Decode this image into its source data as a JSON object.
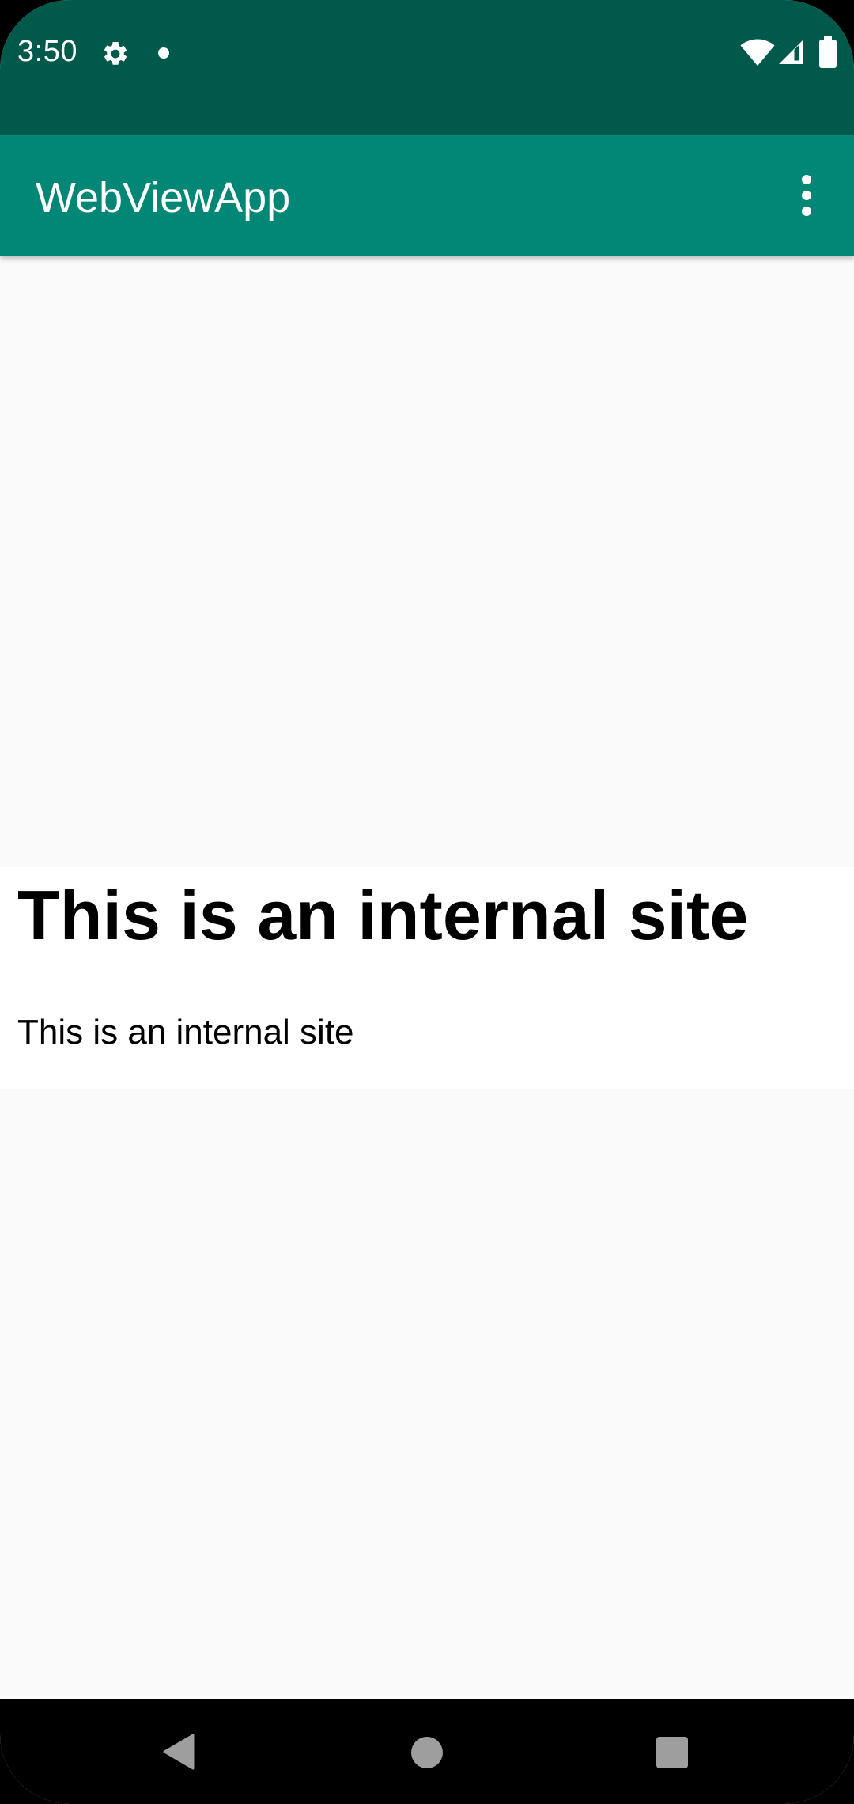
{
  "status_bar": {
    "time": "3:50",
    "icons": [
      "settings-icon",
      "notification-dot-icon",
      "wifi-icon",
      "signal-icon",
      "battery-icon"
    ]
  },
  "app_bar": {
    "title": "WebViewApp",
    "menu_icon": "more-vert-icon"
  },
  "webview": {
    "heading": "This is an internal site",
    "paragraph": "This is an internal site"
  },
  "nav_bar": {
    "buttons": [
      "back-icon",
      "home-icon",
      "recents-icon"
    ]
  },
  "colors": {
    "status_bar": "#01594c",
    "app_bar": "#028676",
    "background": "#fafafa",
    "webview_background": "#ffffff",
    "nav_bar": "#000000"
  }
}
